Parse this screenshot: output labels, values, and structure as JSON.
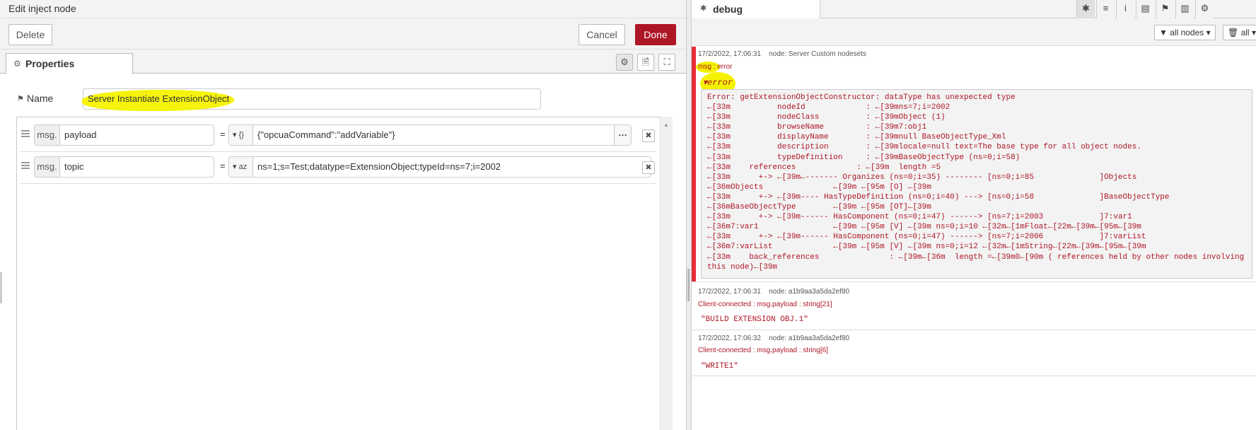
{
  "editor": {
    "title": "Edit inject node",
    "delete_label": "Delete",
    "cancel_label": "Cancel",
    "done_label": "Done",
    "tab_label": "Properties",
    "tab_icon": "gear-icon",
    "name_label": "Name",
    "name_value": "Server Instantiate ExtensionObject",
    "rows": [
      {
        "prefix": "msg.",
        "property": "payload",
        "type_icon": "{}",
        "value": "{\"opcuaCommand\":\"addVariable\"}"
      },
      {
        "prefix": "msg.",
        "property": "topic",
        "type_icon": "az",
        "value": "ns=1;s=Test;datatype=ExtensionObject;typeId=ns=7;i=2002"
      }
    ],
    "equals": "="
  },
  "debug": {
    "tab_label": "debug",
    "filter_label": "all nodes",
    "clear_label": "all",
    "messages": [
      {
        "timestamp": "17/2/2022, 17:06:31",
        "node": "node: Server Custom nodesets",
        "topic": "msg : error",
        "toggle": "error",
        "lines": [
          "Error: getExtensionObjectConstructor: dataType has unexpected type",
          "←[33m          nodeId             : ←[39mns=7;i=2002",
          "←[33m          nodeClass          : ←[39mObject (1)",
          "←[33m          browseName         : ←[39m7:obj1",
          "←[33m          displayName        : ←[39mnull BaseObjectType_Xml",
          "←[33m          description        : ←[39mlocale=null text=The base type for all object nodes.",
          "←[33m          typeDefinition     : ←[39mBaseObjectType (ns=0;i=58)",
          "←[33m    references             : ←[39m  length =5",
          "←[33m      +-> ←[39m←------- Organizes (ns=0;i=35) -------- [ns=0;i=85              ]Objects",
          "←[36mObjects               ←[39m ←[95m [O] ←[39m",
          "←[33m      +-> ←[39m---- HasTypeDefinition (ns=0;i=40) ---> [ns=0;i=58              ]BaseObjectType",
          "←[36mBaseObjectType        ←[39m ←[95m [OT]←[39m",
          "←[33m      +-> ←[39m------ HasComponent (ns=0;i=47) ------> [ns=7;i=2003            ]7:var1",
          "←[36m7:var1                ←[39m ←[95m [V] ←[39m ns=0;i=10 ←[32m←[1mFloat←[22m←[39m←[95m←[39m",
          "←[33m      +-> ←[39m------ HasComponent (ns=0;i=47) ------> [ns=7;i=2006            ]7:varList",
          "←[36m7:varList             ←[39m ←[95m [V] ←[39m ns=0;i=12 ←[32m←[1mString←[22m←[39m←[95m←[39m",
          "←[33m    back_references               : ←[39m←[36m  length =←[39m0←[90m ( references held by other nodes involving",
          "this node)←[39m"
        ]
      },
      {
        "timestamp": "17/2/2022, 17:06:31",
        "node": "node: a1b9aa3a5da2ef80",
        "topic": "Client-connected : msg.payload : string[21]",
        "value": "\"BUILD EXTENSION OBJ.1\""
      },
      {
        "timestamp": "17/2/2022, 17:06:32",
        "node": "node: a1b9aa3a5da2ef80",
        "topic": "Client-connected : msg.payload : string[6]",
        "value": "\"WRITE1\""
      }
    ]
  },
  "colors": {
    "done": "#ad1625",
    "error_band": "#e82c3c",
    "error_text": "#ad1625",
    "highlight": "#f5f200"
  }
}
